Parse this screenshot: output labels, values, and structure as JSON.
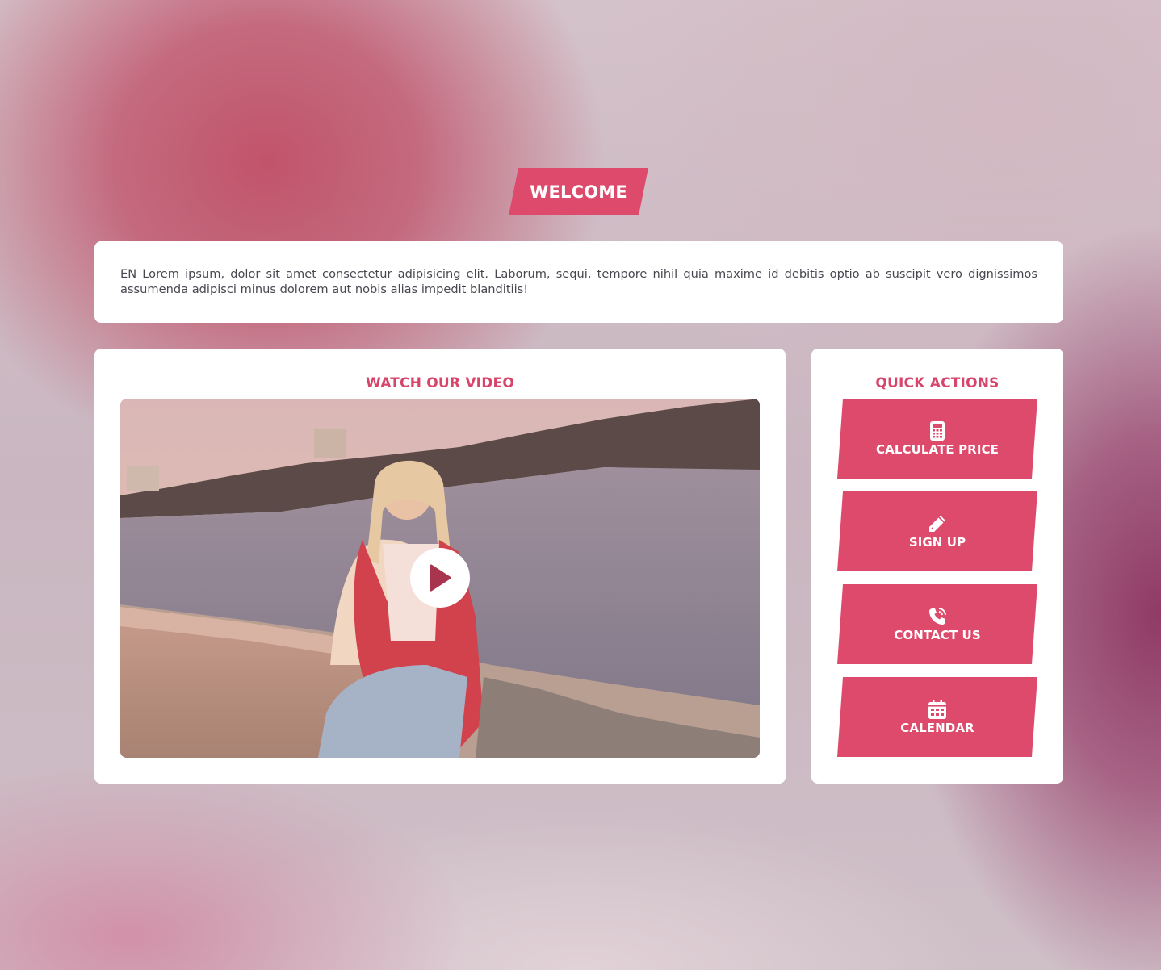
{
  "header": {
    "welcome_label": "WELCOME"
  },
  "intro": {
    "text": "EN Lorem ipsum, dolor sit amet consectetur adipisicing elit. Laborum, sequi, tempore nihil quia maxime id debitis optio ab suscipit vero dignissimos assumenda adipisci minus dolorem aut nobis alias impedit blanditiis!"
  },
  "video": {
    "title": "WATCH OUR VIDEO",
    "play_icon": "play-icon"
  },
  "quick_actions": {
    "title": "QUICK ACTIONS",
    "items": [
      {
        "label": "CALCULATE PRICE",
        "icon": "calculator-icon"
      },
      {
        "label": "SIGN UP",
        "icon": "pencil-icon"
      },
      {
        "label": "CONTACT US",
        "icon": "phone-icon"
      },
      {
        "label": "CALENDAR",
        "icon": "calendar-icon"
      }
    ]
  },
  "colors": {
    "accent": "#de4a6b",
    "title_accent": "#d8456a",
    "card_background": "#ffffff",
    "body_text": "#4a4650"
  }
}
